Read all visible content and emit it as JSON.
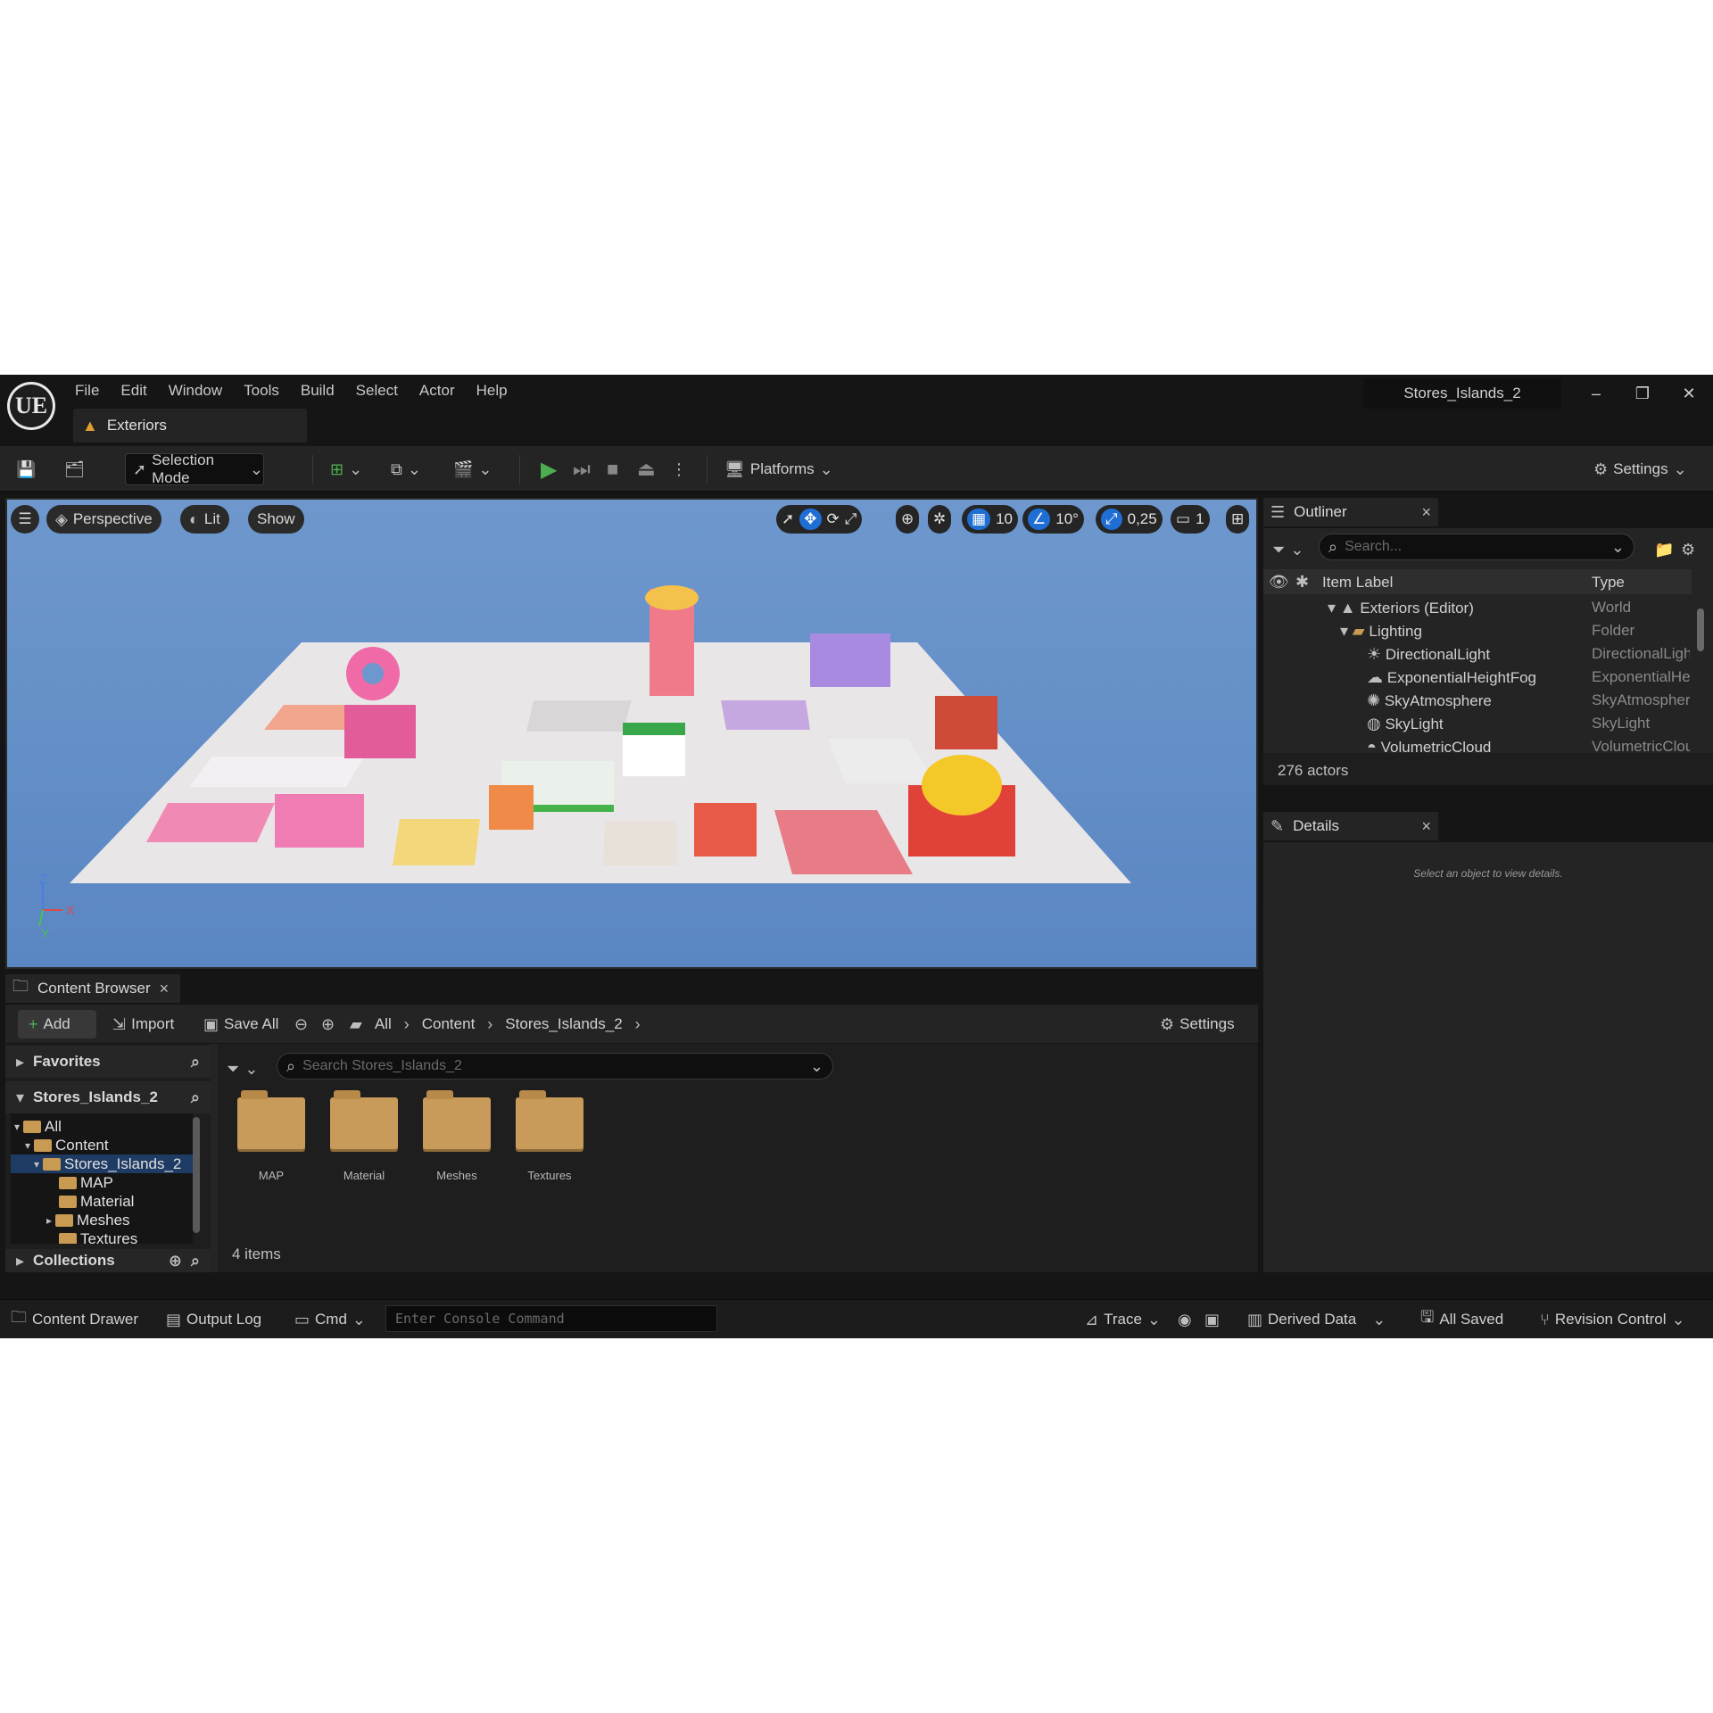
{
  "menubar": {
    "logo": "UE",
    "items": [
      "File",
      "Edit",
      "Window",
      "Tools",
      "Build",
      "Select",
      "Actor",
      "Help"
    ],
    "document_tab": "Exteriors",
    "project_name": "Stores_Islands_2",
    "window_controls": [
      "–",
      "❐",
      "✕"
    ]
  },
  "toolbar": {
    "selection_mode": "Selection Mode",
    "platforms": "Platforms",
    "settings": "Settings"
  },
  "viewport": {
    "perspective": "Perspective",
    "lit": "Lit",
    "show": "Show",
    "grid_snap": "10",
    "rotation_snap": "10°",
    "scale_snap": "0,25",
    "camera_speed": "1",
    "axis_labels": {
      "z": "Z",
      "x": "X",
      "y": "Y"
    }
  },
  "outliner": {
    "tab_label": "Outliner",
    "search_placeholder": "Search...",
    "col_label": "Item Label",
    "col_type": "Type",
    "rows": [
      {
        "label": "Exteriors (Editor)",
        "type": "World"
      },
      {
        "label": "Lighting",
        "type": "Folder"
      },
      {
        "label": "DirectionalLight",
        "type": "DirectionalLight"
      },
      {
        "label": "ExponentialHeightFog",
        "type": "ExponentialHe"
      },
      {
        "label": "SkyAtmosphere",
        "type": "SkyAtmosphere"
      },
      {
        "label": "SkyLight",
        "type": "SkyLight"
      },
      {
        "label": "VolumetricCloud",
        "type": "VolumetricClou"
      }
    ],
    "actor_count": "276 actors"
  },
  "details": {
    "tab_label": "Details",
    "empty_message": "Select an object to view details."
  },
  "content_browser": {
    "tab_label": "Content Browser",
    "add": "Add",
    "import": "Import",
    "save_all": "Save All",
    "breadcrumb": [
      "All",
      "Content",
      "Stores_Islands_2"
    ],
    "settings": "Settings",
    "favorites": "Favorites",
    "source_root": "Stores_Islands_2",
    "search_placeholder": "Search Stores_Islands_2",
    "tree": [
      "All",
      "Content",
      "Stores_Islands_2",
      "MAP",
      "Material",
      "Meshes",
      "Textures"
    ],
    "collections": "Collections",
    "assets": [
      "MAP",
      "Material",
      "Meshes",
      "Textures"
    ],
    "item_count": "4 items"
  },
  "statusbar": {
    "content_drawer": "Content Drawer",
    "output_log": "Output Log",
    "cmd": "Cmd",
    "console_placeholder": "Enter Console Command",
    "trace": "Trace",
    "derived_data": "Derived Data",
    "all_saved": "All Saved",
    "revision_control": "Revision Control"
  },
  "colors": {
    "accent_blue": "#1f6ed4",
    "play_green": "#4caf50",
    "folder": "#c89b5a",
    "sky": "#6e98cd"
  }
}
